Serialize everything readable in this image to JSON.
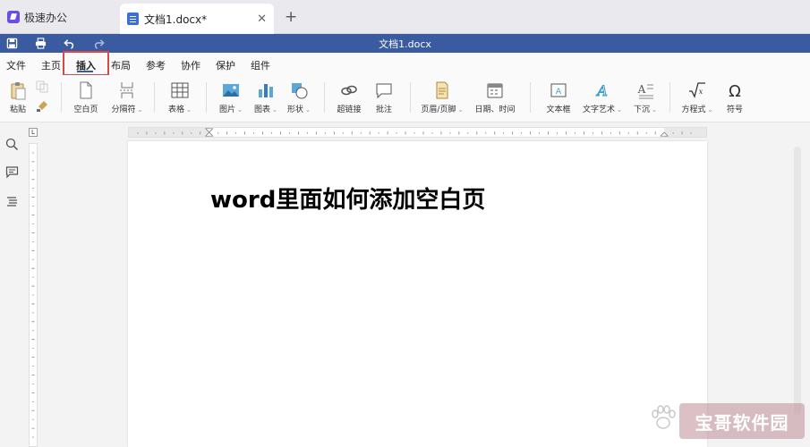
{
  "tabs": {
    "app_name": "极速办公",
    "doc_tab_label": "文档1.docx*",
    "close_symbol": "✕",
    "add_symbol": "+"
  },
  "titlebar": {
    "title": "文档1.docx",
    "icons": [
      "save-icon",
      "print-icon",
      "undo-icon",
      "redo-icon"
    ],
    "bg_color": "#3a5ba0"
  },
  "menu": {
    "items": [
      "文件",
      "主页",
      "插入",
      "布局",
      "参考",
      "协作",
      "保护",
      "组件"
    ],
    "active": "插入",
    "highlight_color": "#d24a4a"
  },
  "ribbon": {
    "paste": "粘贴",
    "blank_page": "空白页",
    "page_break": "分隔符",
    "table": "表格",
    "picture": "图片",
    "chart": "图表",
    "shape": "形状",
    "hyperlink": "超链接",
    "comment": "批注",
    "header_footer": "页眉/页脚",
    "date_time": "日期、时间",
    "text_box": "文本框",
    "word_art": "文字艺术",
    "drop_cap": "下沉",
    "equation": "方程式",
    "symbol": "符号"
  },
  "ruler": {
    "corner": "L"
  },
  "document": {
    "heading": "word里面如何添加空白页"
  },
  "watermark": {
    "text": "宝哥软件园"
  }
}
